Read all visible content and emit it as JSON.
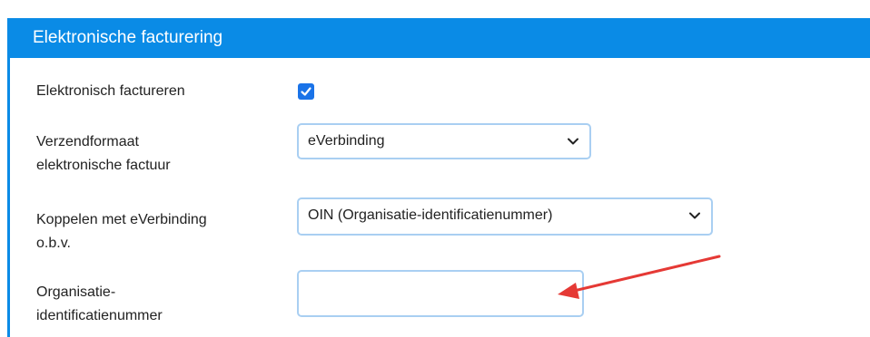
{
  "section": {
    "title": "Elektronische facturering"
  },
  "fields": {
    "e_invoice": {
      "label": "Elektronisch factureren",
      "checked": true
    },
    "send_format": {
      "label_line1": "Verzendformaat",
      "label_line2": "elektronische factuur",
      "value": "eVerbinding"
    },
    "link_by": {
      "label_line1": "Koppelen met eVerbinding",
      "label_line2": "o.b.v.",
      "value": "OIN (Organisatie-identificatienummer)"
    },
    "oin": {
      "label_line1": "Organisatie-",
      "label_line2": "identificatienummer",
      "value": ""
    }
  },
  "icons": {
    "checkbox": "check-icon",
    "dropdown": "chevron-down-icon",
    "annotation": "red-arrow"
  },
  "colors": {
    "header_bg": "#0a8be6",
    "checkbox_bg": "#1a73e8",
    "input_border": "#a9cff2",
    "annotation_arrow": "#e53935"
  }
}
